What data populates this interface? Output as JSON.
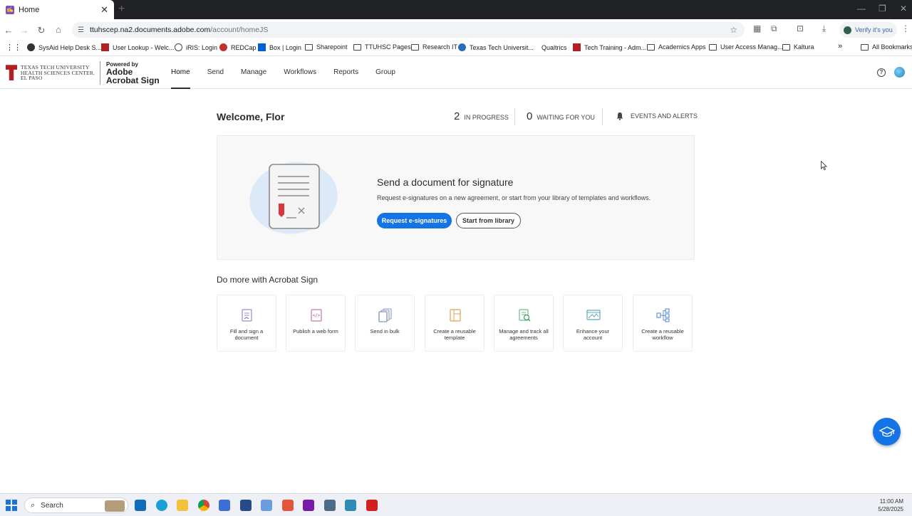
{
  "browser": {
    "tab_title": "Home",
    "tab_close": "✕",
    "new_tab": "+",
    "url_host": "ttuhscep.na2.documents.adobe.com",
    "url_path": "/account/homeJS",
    "verify_label": "Verify it's you",
    "all_bookmarks": "All Bookmarks",
    "bookmarks": [
      {
        "label": "SysAid Help Desk S..."
      },
      {
        "label": "User Lookup - Welc..."
      },
      {
        "label": "iRIS: Login"
      },
      {
        "label": "REDCap"
      },
      {
        "label": "Box | Login"
      },
      {
        "label": "Sharepoint"
      },
      {
        "label": "TTUHSC Pages"
      },
      {
        "label": "Research IT"
      },
      {
        "label": "Texas Tech Universit..."
      },
      {
        "label": "Qualtrics"
      },
      {
        "label": "Tech Training - Adm..."
      },
      {
        "label": "Academics Apps"
      },
      {
        "label": "User Access Manag..."
      },
      {
        "label": "Kaltura"
      }
    ]
  },
  "app": {
    "org_line1": "TEXAS TECH UNIVERSITY",
    "org_line2": "HEALTH SCIENCES CENTER.",
    "org_line3": "EL PASO",
    "powered_by": "Powered by",
    "product_line1": "Adobe",
    "product_line2": "Acrobat Sign",
    "nav": [
      "Home",
      "Send",
      "Manage",
      "Workflows",
      "Reports",
      "Group"
    ],
    "help": "?"
  },
  "dashboard": {
    "welcome": "Welcome, Flor",
    "in_progress_count": "2",
    "in_progress_label": "IN PROGRESS",
    "waiting_count": "0",
    "waiting_label": "WAITING FOR YOU",
    "events_label": "EVENTS AND ALERTS"
  },
  "send_card": {
    "title": "Send a document for signature",
    "description": "Request e-signatures on a new agreement, or start from your library of templates and workflows.",
    "primary_button": "Request e-signatures",
    "secondary_button": "Start from library"
  },
  "do_more": {
    "heading": "Do more with Acrobat Sign",
    "tiles": [
      {
        "label": "Fill and sign a document",
        "icon": "fill-sign-icon"
      },
      {
        "label": "Publish a web form",
        "icon": "web-form-icon"
      },
      {
        "label": "Send in bulk",
        "icon": "send-bulk-icon"
      },
      {
        "label": "Create a reusable template",
        "icon": "template-icon"
      },
      {
        "label": "Manage and track all agreements",
        "icon": "manage-track-icon"
      },
      {
        "label": "Enhance your account",
        "icon": "enhance-account-icon"
      },
      {
        "label": "Create a reusable workflow",
        "icon": "workflow-icon"
      }
    ]
  },
  "taskbar": {
    "search": "Search",
    "time": "11:00 AM",
    "date": "5/28/2025"
  },
  "colors": {
    "accent": "#1473e6",
    "ttu_red": "#b41f24"
  }
}
